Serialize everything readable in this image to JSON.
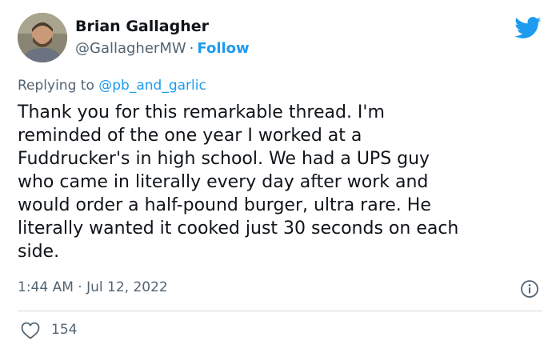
{
  "author": {
    "name": "Brian Gallagher",
    "handle": "@GallagherMW",
    "separator": "·",
    "follow_label": "Follow"
  },
  "reply": {
    "prefix": "Replying to",
    "mention": "@pb_and_garlic"
  },
  "tweet": {
    "text": "Thank you for this remarkable thread. I'm\nreminded of the one year I worked at a\nFuddrucker's in high school. We had a UPS guy\nwho came in literally every day after work and\nwould order a half-pound burger, ultra rare. He\nliterally wanted it cooked just 30 seconds on each\nside.",
    "timestamp": "1:44 AM · Jul 12, 2022"
  },
  "engagement": {
    "likes": "154"
  },
  "icons": {
    "brand": "twitter-bird-icon",
    "info": "info-icon",
    "like": "heart-icon"
  },
  "colors": {
    "accent": "#1d9bf0",
    "text": "#0f1419",
    "muted": "#536471",
    "divider": "#cfd9de"
  }
}
